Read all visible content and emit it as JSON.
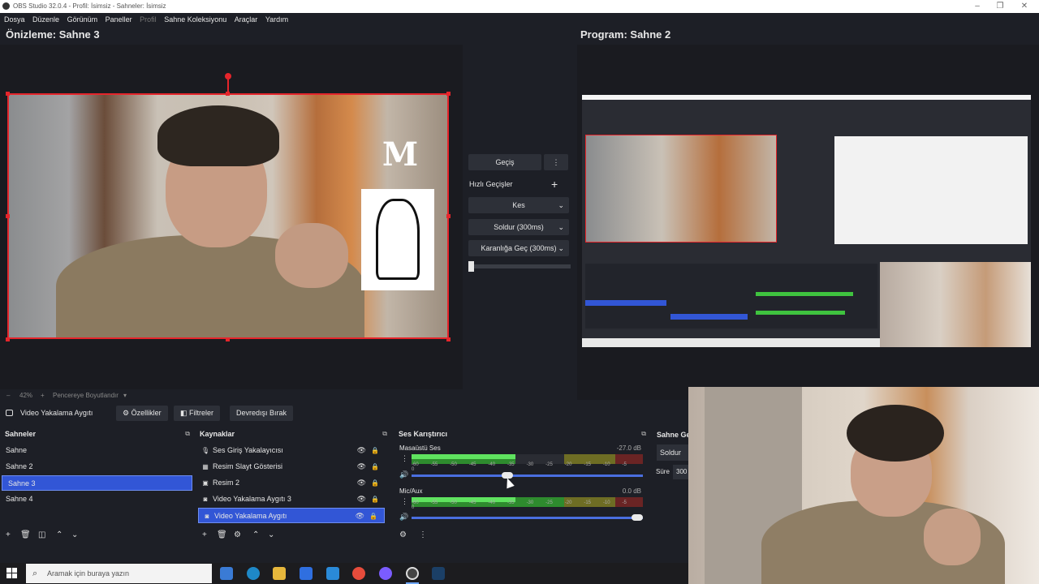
{
  "window": {
    "title": "OBS Studio 32.0.4 - Profil: İsimsiz - Sahneler: İsimsiz"
  },
  "menu": [
    {
      "label": "Dosya",
      "dim": false
    },
    {
      "label": "Düzenle",
      "dim": false
    },
    {
      "label": "Görünüm",
      "dim": false
    },
    {
      "label": "Paneller",
      "dim": false
    },
    {
      "label": "Profil",
      "dim": true
    },
    {
      "label": "Sahne Koleksiyonu",
      "dim": false
    },
    {
      "label": "Araçlar",
      "dim": false
    },
    {
      "label": "Yardım",
      "dim": false
    }
  ],
  "preview": {
    "label": "Önizleme: Sahne 3",
    "zoom": "42%",
    "fit_label": "Pencereye Boyutlandır"
  },
  "program": {
    "label": "Program: Sahne 2"
  },
  "transitions": {
    "transition_button": "Geçiş",
    "quick_label": "Hızlı Geçişler",
    "items": [
      "Kes",
      "Soldur (300ms)",
      "Karanlığa Geç (300ms)"
    ],
    "tbar_position": 0
  },
  "source_bar": {
    "source_name": "Video Yakalama Aygıtı",
    "properties": "Özellikler",
    "filters": "Filtreler",
    "deactivate": "Devredışı Bırak"
  },
  "scenes": {
    "title": "Sahneler",
    "items": [
      "Sahne",
      "Sahne 2",
      "Sahne 3",
      "Sahne 4"
    ],
    "selected_index": 2
  },
  "sources": {
    "title": "Kaynaklar",
    "items": [
      {
        "label": "Ses Giriş Yakalayıcısı",
        "icon": "mic-icon"
      },
      {
        "label": "Resim Slayt Gösterisi",
        "icon": "slideshow-icon"
      },
      {
        "label": "Resim 2",
        "icon": "image-icon"
      },
      {
        "label": "Video Yakalama Aygıtı 3",
        "icon": "camera-icon"
      },
      {
        "label": "Video Yakalama Aygıtı",
        "icon": "camera-icon"
      }
    ],
    "selected_index": 4
  },
  "mixer": {
    "title": "Ses Karıştırıcı",
    "channels": [
      {
        "name": "Masaüstü Ses",
        "db": "-27.0 dB",
        "level": 0.45,
        "fader": 0.41
      },
      {
        "name": "Mic/Aux",
        "db": "0.0 dB",
        "level": 0.82,
        "fader": 1.0
      }
    ],
    "scale": [
      "-60",
      "-55",
      "-50",
      "-45",
      "-40",
      "-35",
      "-30",
      "-25",
      "-20",
      "-15",
      "-10",
      "-5",
      "0"
    ]
  },
  "scene_transitions_dock": {
    "title": "Sahne Ge",
    "value": "Soldur",
    "duration_label": "Süre",
    "duration_value": "300"
  },
  "taskbar": {
    "search_placeholder": "Aramak için buraya yazın"
  },
  "colors": {
    "accent": "#3256d6",
    "selection_red": "#e5252b",
    "meter_green": "#5fe35f"
  }
}
